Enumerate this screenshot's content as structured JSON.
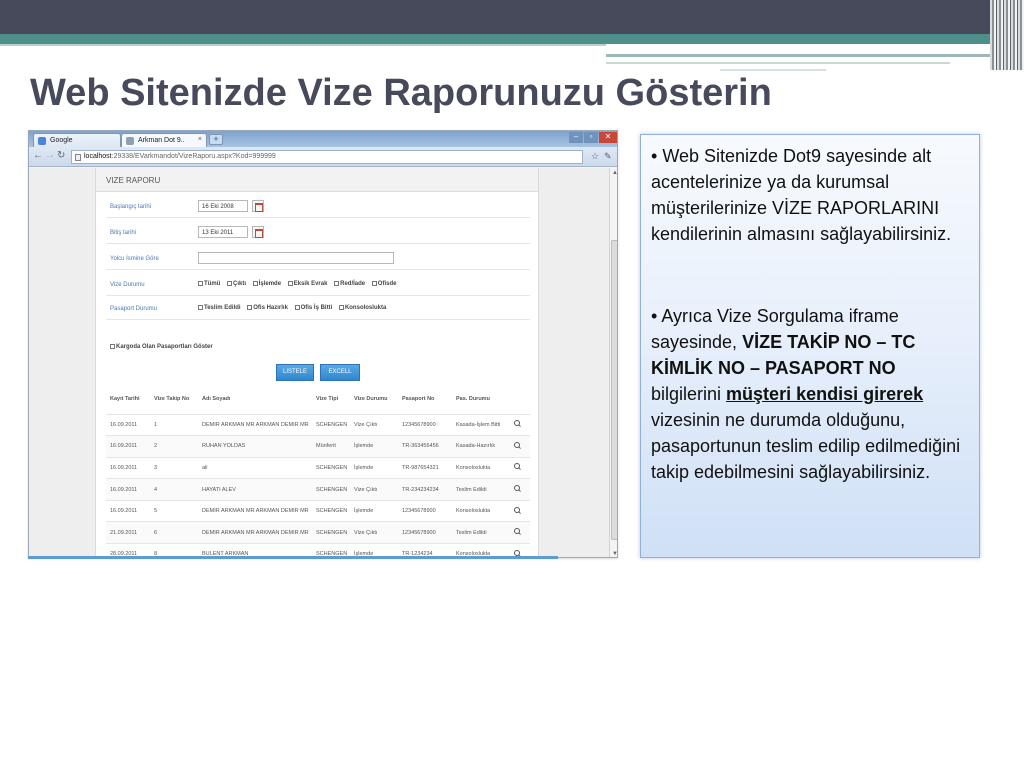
{
  "slide": {
    "title": "Web Sitenizde Vize Raporunuzu Gösterin"
  },
  "browser": {
    "tabs": [
      {
        "label": "Google"
      },
      {
        "label": "Arkman Dot 9.."
      }
    ],
    "tab_close": "×",
    "new_tab": "+",
    "url_host": "localhost",
    "url_path": ":29338/EVarkmandot/VizeRaporu.aspx?Kod=999999"
  },
  "report": {
    "header": "VIZE RAPORU",
    "start_label": "Başlangıç tarihi",
    "start_value": "16 Eki 2008",
    "end_label": "Bitiş tarihi",
    "end_value": "13 Eki 2011",
    "traveler_label": "Yolcu İsmine Göre",
    "traveler_value": "",
    "visa_status_label": "Vize Durumu",
    "visa_status_options": [
      "Tümü",
      "Çıktı",
      "İşlemde",
      "Eksik Evrak",
      "Red/İade",
      "Ofisde"
    ],
    "passport_status_label": "Pasaport Durumu",
    "passport_status_options": [
      "Teslim Edildi",
      "Ofis Hazırlık",
      "Ofis İş Bitti",
      "Konsoloslukta"
    ],
    "cargo_label": "Kargoda Olan Pasaportları Göster",
    "list_button": "LISTELE",
    "excel_button": "EXCELL",
    "columns": [
      "Kayıt Tarihi",
      "Vize Takip No",
      "Adı Soyadı",
      "Vize Tipi",
      "Vize Durumu",
      "Pasaport No",
      "Pas. Durumu"
    ],
    "rows": [
      [
        "16.09.2011",
        "1",
        "DEMIR ARKMAN MR ARKMAN DEMIR MR",
        "SCHENGEN",
        "Vize Çıktı",
        "12345678900",
        "Kasada-İşlem Bitti"
      ],
      [
        "16.09.2011",
        "2",
        "RUHAN YOLDAS",
        "Münferit",
        "İşlemde",
        "TR-363456456",
        "Kasada-Hazırlık"
      ],
      [
        "16.09.2011",
        "3",
        "ali",
        "SCHENGEN",
        "İşlemde",
        "TR-987654321",
        "Konsoloslukta"
      ],
      [
        "16.09.2011",
        "4",
        "HAYATI ALEV",
        "SCHENGEN",
        "Vize Çıktı",
        "TR-234234234",
        "Teslim Edildi"
      ],
      [
        "16.09.2011",
        "5",
        "DEMIR ARKMAN MR ARKMAN DEMIR MR",
        "SCHENGEN",
        "İşlemde",
        "12345678900",
        "Konsoloslukta"
      ],
      [
        "21.09.2011",
        "6",
        "DEMIR ARKMAN MR ARKMAN DEMIR MR",
        "SCHENGEN",
        "Vize Çıktı",
        "12345678900",
        "Teslim Edildi"
      ],
      [
        "28.09.2011",
        "8",
        "BULENT ARKMAN",
        "SCHENGEN",
        "İşlemde",
        "TR-1234234",
        "Konsoloslukta"
      ]
    ]
  },
  "textbox": {
    "b1": "Web Sitenizde Dot9 sayesinde alt acentelerinize ya da kurumsal müşterilerinize VİZE RAPORLARINI kendilerinin almasını sağlayabilirsiniz.",
    "b2_a": "Ayrıca Vize Sorgulama iframe sayesinde, ",
    "b2_b": "VİZE TAKİP NO – TC KİMLİK NO – PASAPORT NO",
    "b2_c": " bilgilerini ",
    "b2_d": "müşteri kendisi girerek",
    "b2_e": " vizesinin ne durumda olduğunu, pasaportunun teslim edilip edilmediğini takip edebilmesini sağlayabilirsiniz."
  }
}
